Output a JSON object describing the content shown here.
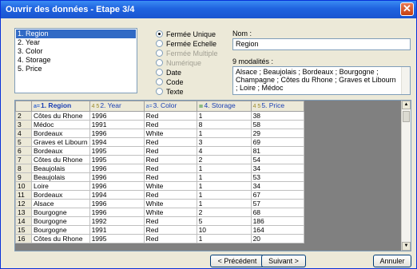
{
  "window": {
    "title": "Ouvrir des données - Etape 3/4",
    "close_glyph": "✕"
  },
  "variables": [
    {
      "label": "1. Region",
      "selected": true
    },
    {
      "label": "2. Year",
      "selected": false
    },
    {
      "label": "3. Color",
      "selected": false
    },
    {
      "label": "4. Storage",
      "selected": false
    },
    {
      "label": "5. Price",
      "selected": false
    }
  ],
  "types": [
    {
      "label": "Fermée Unique",
      "checked": true,
      "disabled": false
    },
    {
      "label": "Fermée Echelle",
      "checked": false,
      "disabled": false
    },
    {
      "label": "Fermée Multiple",
      "checked": false,
      "disabled": true
    },
    {
      "label": "Numérique",
      "checked": false,
      "disabled": true
    },
    {
      "label": "Date",
      "checked": false,
      "disabled": false
    },
    {
      "label": "Code",
      "checked": false,
      "disabled": false
    },
    {
      "label": "Texte",
      "checked": false,
      "disabled": false
    }
  ],
  "nom": {
    "label": "Nom :",
    "value": "Region"
  },
  "modalites": {
    "label": "9 modalités :",
    "text": "Alsace ; Beaujolais ; Bordeaux ; Bourgogne ; Champagne ; Côtes du Rhone ; Graves et Libourn ; Loire ; Médoc"
  },
  "grid": {
    "columns": [
      {
        "icon": "text-type-icon",
        "glyph": "a=",
        "label": "1. Region",
        "active": true
      },
      {
        "icon": "numeric-type-icon",
        "glyph": "4 5",
        "label": "2. Year",
        "active": false
      },
      {
        "icon": "text-type-icon",
        "glyph": "a=",
        "label": "3. Color",
        "active": false
      },
      {
        "icon": "ordinal-type-icon",
        "glyph": "≣",
        "label": "4. Storage",
        "active": false
      },
      {
        "icon": "numeric-type-icon",
        "glyph": "4 5",
        "label": "5. Price",
        "active": false
      }
    ],
    "rows": [
      [
        "2",
        "Côtes du Rhone",
        "1996",
        "Red",
        "1",
        "38"
      ],
      [
        "3",
        "Médoc",
        "1991",
        "Red",
        "8",
        "58"
      ],
      [
        "4",
        "Bordeaux",
        "1996",
        "White",
        "1",
        "29"
      ],
      [
        "5",
        "Graves et Libourn",
        "1994",
        "Red",
        "3",
        "69"
      ],
      [
        "6",
        "Bordeaux",
        "1995",
        "Red",
        "4",
        "81"
      ],
      [
        "7",
        "Côtes du Rhone",
        "1995",
        "Red",
        "2",
        "54"
      ],
      [
        "8",
        "Beaujolais",
        "1996",
        "Red",
        "1",
        "34"
      ],
      [
        "9",
        "Beaujolais",
        "1996",
        "Red",
        "1",
        "53"
      ],
      [
        "10",
        "Loire",
        "1996",
        "White",
        "1",
        "34"
      ],
      [
        "11",
        "Bordeaux",
        "1994",
        "Red",
        "1",
        "67"
      ],
      [
        "12",
        "Alsace",
        "1996",
        "White",
        "1",
        "57"
      ],
      [
        "13",
        "Bourgogne",
        "1996",
        "White",
        "2",
        "68"
      ],
      [
        "14",
        "Bourgogne",
        "1992",
        "Red",
        "5",
        "186"
      ],
      [
        "15",
        "Bourgogne",
        "1991",
        "Red",
        "10",
        "164"
      ],
      [
        "16",
        "Côtes du Rhone",
        "1995",
        "Red",
        "1",
        "20"
      ]
    ]
  },
  "buttons": {
    "prev": "< Précédent",
    "next": "Suivant >",
    "cancel": "Annuler"
  },
  "colors": {
    "titlebar": "#1f63df",
    "selection": "#316ac5",
    "header_text": "#1a3fb3"
  }
}
